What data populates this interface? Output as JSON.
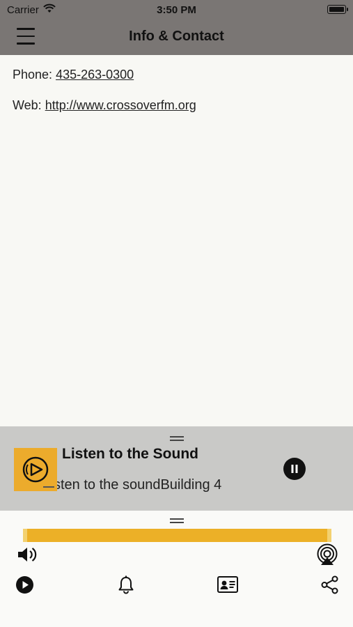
{
  "status_bar": {
    "carrier": "Carrier",
    "time": "3:50 PM"
  },
  "nav": {
    "title": "Info & Contact",
    "menu_icon": "hamburger-menu-icon"
  },
  "contact": {
    "phone_label": "Phone: ",
    "phone_value": "435-263-0300",
    "web_label": "Web: ",
    "web_value": "http://www.crossoverfm.org"
  },
  "player": {
    "title": "Listen to the Sound",
    "subtitle": "sten to the soundBuilding 4",
    "pause_icon": "pause-icon",
    "art_icon": "station-logo-icon"
  },
  "bottom_bar": {
    "icons": [
      "volume-icon",
      "airplay-icon",
      "play-icon",
      "bell-icon",
      "contact-card-icon",
      "share-icon"
    ]
  },
  "colors": {
    "header": "#7a7674",
    "player_bg": "#c9c9c7",
    "accent": "#ecab2c",
    "page_bg": "#f8f8f4"
  }
}
